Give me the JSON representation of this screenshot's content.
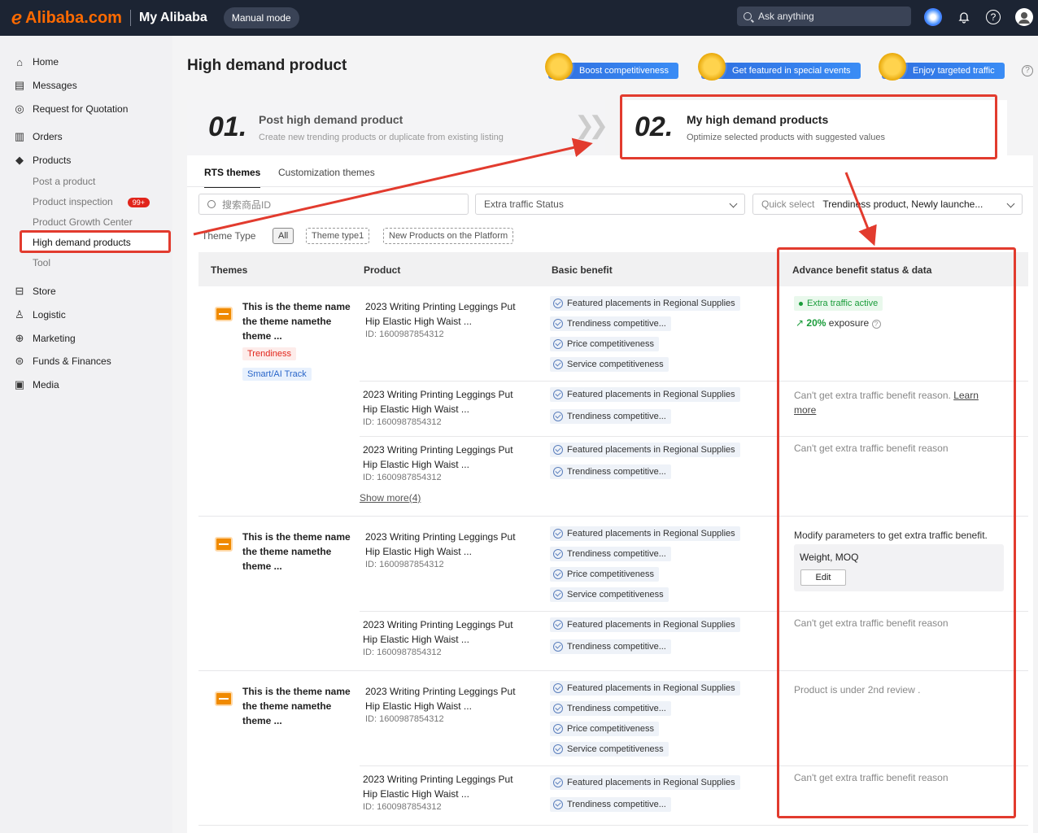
{
  "topbar": {
    "logo": "Alibaba.com",
    "app": "My Alibaba",
    "mode": "Manual mode",
    "search_placeholder": "Ask anything"
  },
  "sidebar": {
    "items": [
      {
        "label": "Home",
        "icon": "home-icon"
      },
      {
        "label": "Messages",
        "icon": "messages-icon"
      },
      {
        "label": "Request for Quotation",
        "icon": "rfq-icon"
      },
      {
        "label": "Orders",
        "icon": "orders-icon"
      },
      {
        "label": "Products",
        "icon": "products-icon"
      },
      {
        "label": "Store",
        "icon": "store-icon"
      },
      {
        "label": "Logistic",
        "icon": "logistic-icon"
      },
      {
        "label": "Marketing",
        "icon": "marketing-icon"
      },
      {
        "label": "Funds & Finances",
        "icon": "funds-icon"
      },
      {
        "label": "Media",
        "icon": "media-icon"
      }
    ],
    "sub_items": [
      "Post a product",
      "Product inspection",
      "Product Growth Center",
      "High demand products",
      "Tool"
    ],
    "inspection_badge": "99+"
  },
  "page": {
    "title": "High demand product",
    "benefits": [
      "Boost competitiveness",
      "Get featured in special events",
      "Enjoy targeted traffic"
    ],
    "step1": {
      "num": "01.",
      "title": "Post high demand product",
      "sub": "Create new trending products or duplicate from existing listing"
    },
    "step2": {
      "num": "02.",
      "title": "My high demand products",
      "sub": "Optimize selected products with suggested values"
    }
  },
  "tabs": [
    "RTS themes",
    "Customization themes"
  ],
  "filters": {
    "search_placeholder": "搜索商品ID",
    "traffic_status": "Extra traffic Status",
    "quick_select_label": "Quick select",
    "quick_select_value": "Trendiness product, Newly launche..."
  },
  "theme_type": {
    "label": "Theme Type",
    "options": [
      "All",
      "Theme type1",
      "New Products on the Platform"
    ]
  },
  "table": {
    "headers": [
      "Themes",
      "Product",
      "Basic benefit",
      "Advance benefit  status & data"
    ],
    "theme_name": "This is the theme name the theme namethe theme ...",
    "theme_name_lines": [
      "This is the theme name",
      "the theme namethe",
      "theme ..."
    ],
    "tags": [
      "Trendiness",
      "Smart/AI Track"
    ],
    "product_title_lines": [
      "2023 Writing Printing Leggings Put",
      "Hip Elastic High Waist ..."
    ],
    "product_id": "ID: 1600987854312",
    "benefits": [
      "Featured placements in Regional Supplies",
      "Trendiness competitive...",
      "Price competitiveness",
      "Service competitiveness"
    ],
    "show_more": "Show more(4)",
    "adv": {
      "active": "Extra traffic active",
      "exposure_value": "20%",
      "exposure_label": "exposure",
      "reason_learn": "Can't get extra traffic benefit reason.",
      "learn_more_1": "Learn",
      "learn_more_2": "more",
      "reason": "Can't get extra traffic benefit reason",
      "modify": "Modify parameters to get extra traffic benefit.",
      "modify_params": "Weight, MOQ",
      "edit": "Edit",
      "reason2": "Can't get extra traffic  benefit reason",
      "review": "Product is under 2nd review .",
      "reason3": "Can't get extra traffic  benefit reason"
    }
  },
  "colors": {
    "accent": "#ff6a00",
    "topbar": "#1c2433",
    "highlight": "#e23b2e",
    "benefit_blue": "#2f6fe0",
    "green": "#1a9c3a"
  }
}
